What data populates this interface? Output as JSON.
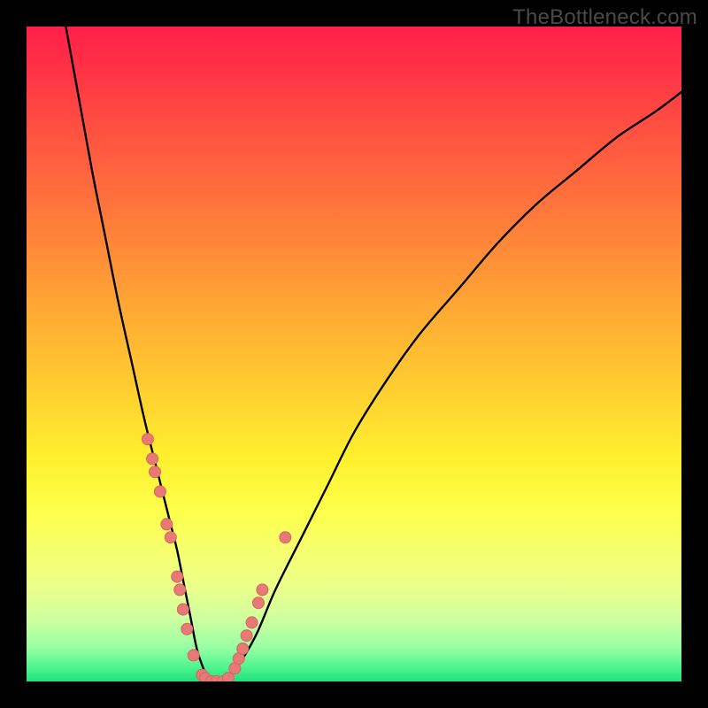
{
  "watermark": "TheBottleneck.com",
  "colors": {
    "curve_stroke": "#000000",
    "marker_fill": "#e77a76",
    "marker_stroke": "#d76460"
  },
  "chart_data": {
    "type": "line",
    "title": "",
    "xlabel": "",
    "ylabel": "",
    "xlim": [
      0,
      100
    ],
    "ylim": [
      0,
      100
    ],
    "curve": {
      "name": "bottleneck-curve",
      "x": [
        6,
        8,
        10,
        12,
        14,
        16,
        18,
        20,
        21,
        22,
        23,
        24,
        25,
        26,
        27,
        28,
        30,
        32,
        35,
        38,
        42,
        46,
        50,
        55,
        60,
        66,
        72,
        78,
        84,
        90,
        96,
        100
      ],
      "y": [
        100,
        89,
        78,
        68,
        58,
        49,
        40,
        32,
        28,
        24,
        20,
        15,
        10,
        5,
        2,
        0,
        0,
        2,
        7,
        14,
        22,
        30,
        38,
        46,
        53,
        60,
        67,
        73,
        78,
        83,
        87,
        90
      ]
    },
    "series": [
      {
        "name": "markers-left-branch",
        "type": "scatter",
        "x": [
          18.5,
          19.2,
          19.6,
          20.4,
          21.4,
          22.0,
          23.0,
          23.4,
          23.9,
          24.5,
          25.5,
          26.8,
          27.3
        ],
        "y": [
          37,
          34,
          32,
          29,
          24,
          22,
          16,
          14,
          11,
          8,
          4,
          1,
          0.5
        ]
      },
      {
        "name": "markers-bottom",
        "type": "scatter",
        "x": [
          28.2,
          29.0,
          30.0,
          30.8
        ],
        "y": [
          0,
          0,
          0,
          0.5
        ]
      },
      {
        "name": "markers-right-branch",
        "type": "scatter",
        "x": [
          31.8,
          32.4,
          33.0,
          33.6,
          34.4,
          35.4,
          36.0,
          39.5
        ],
        "y": [
          2,
          3.5,
          5,
          7,
          9,
          12,
          14,
          22
        ]
      }
    ]
  }
}
